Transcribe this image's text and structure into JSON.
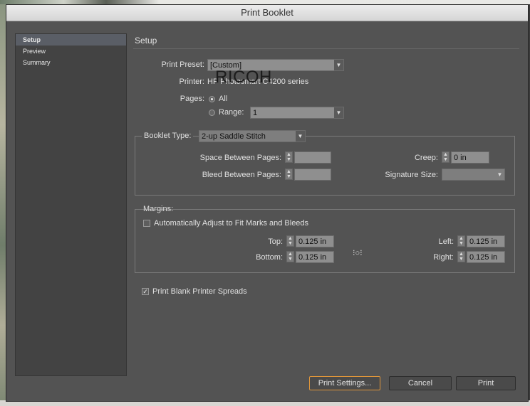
{
  "window": {
    "title": "Print Booklet"
  },
  "sidebar": {
    "items": [
      {
        "label": "Setup"
      },
      {
        "label": "Preview"
      },
      {
        "label": "Summary"
      }
    ]
  },
  "main": {
    "title": "Setup"
  },
  "print_preset": {
    "label": "Print Preset:",
    "value": "[Custom]"
  },
  "printer": {
    "label": "Printer:",
    "value": "HP Photosmart C4200 series",
    "watermark": "RICOH"
  },
  "pages": {
    "label": "Pages:",
    "all_label": "All",
    "range_label": "Range:",
    "range_value": "1"
  },
  "booklet": {
    "type_label": "Booklet Type:",
    "type_value": "2-up Saddle Stitch",
    "space_label": "Space Between Pages:",
    "space_value": "",
    "bleed_label": "Bleed Between Pages:",
    "bleed_value": "",
    "creep_label": "Creep:",
    "creep_value": "0 in",
    "signature_label": "Signature Size:",
    "signature_value": ""
  },
  "margins": {
    "title": "Margins:",
    "auto_label": "Automatically Adjust to Fit Marks and Bleeds",
    "auto_checked": false,
    "top_label": "Top:",
    "top_value": "0.125 in",
    "bottom_label": "Bottom:",
    "bottom_value": "0.125 in",
    "left_label": "Left:",
    "left_value": "0.125 in",
    "right_label": "Right:",
    "right_value": "0.125 in"
  },
  "blank_spreads": {
    "label": "Print Blank Printer Spreads",
    "checked": true,
    "mark": "✓"
  },
  "buttons": {
    "print_settings": "Print Settings...",
    "cancel": "Cancel",
    "print": "Print"
  },
  "colors": {
    "window_bg": "#535353",
    "focus_ring": "#e0963a",
    "sidebar_selected": "#5a5e66"
  }
}
